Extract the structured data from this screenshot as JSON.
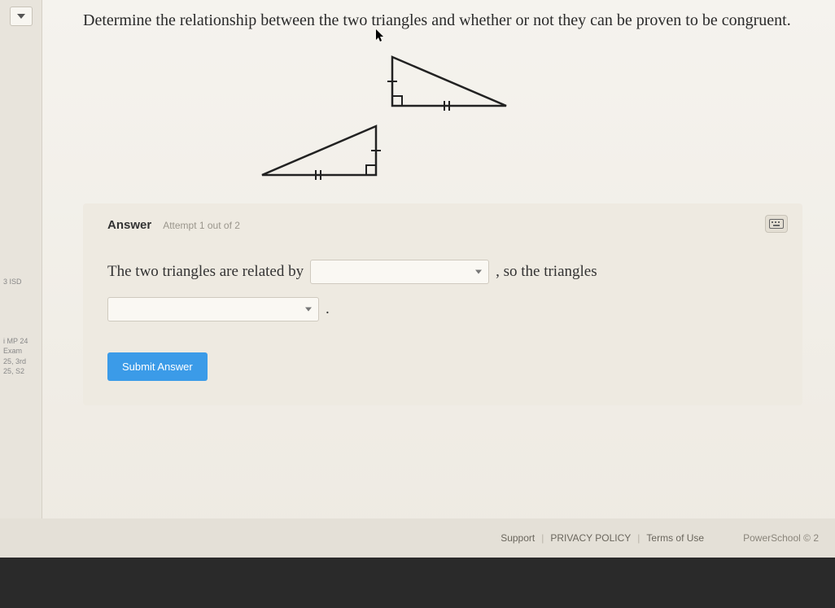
{
  "question": "Determine the relationship between the two triangles and whether or not they can be proven to be congruent.",
  "answer_section": {
    "label": "Answer",
    "attempt": "Attempt 1 out of 2",
    "sentence_part1": "The two triangles are related by",
    "sentence_part2": ", so the triangles",
    "period": "."
  },
  "buttons": {
    "submit": "Submit Answer"
  },
  "sidebar": {
    "items": [
      "3 ISD",
      "i MP 24",
      "Exam",
      "25, 3rd",
      "25, S2"
    ]
  },
  "footer": {
    "support": "Support",
    "privacy": "PRIVACY POLICY",
    "terms": "Terms of Use",
    "brand": "PowerSchool © 2"
  }
}
